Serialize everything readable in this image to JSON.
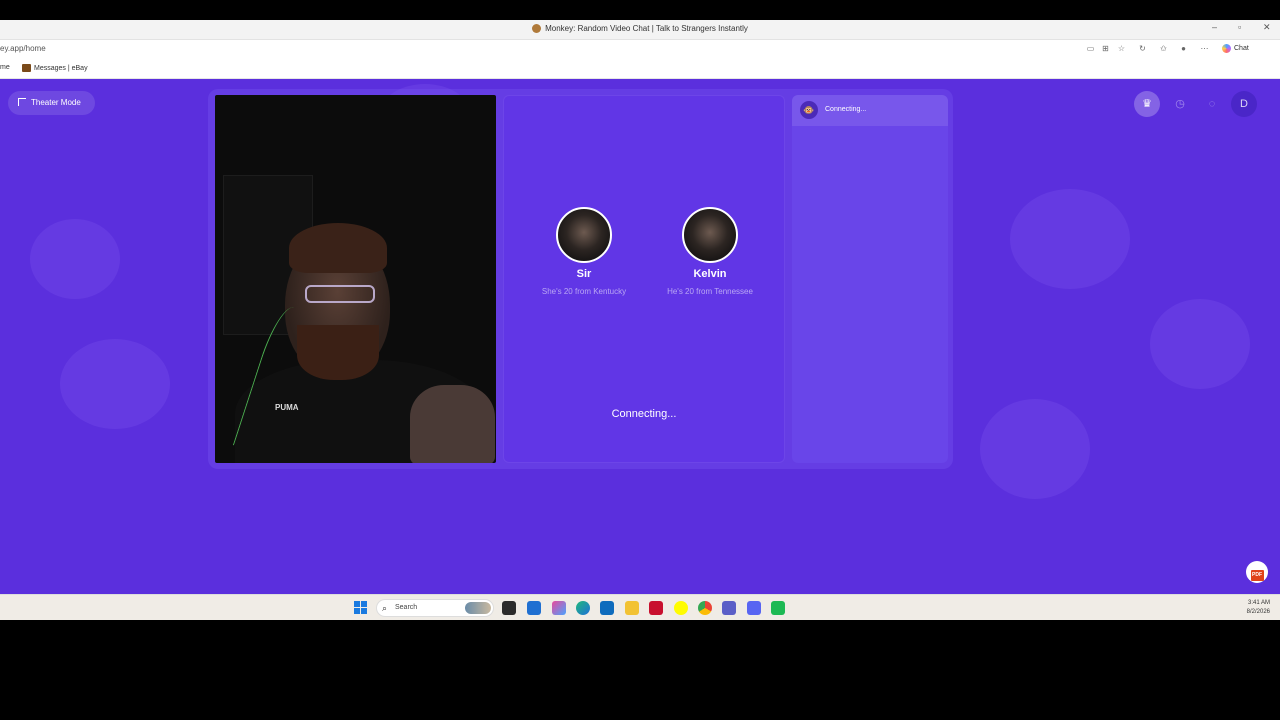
{
  "browser": {
    "window_title": "Monkey: Random Video Chat | Talk to Strangers Instantly",
    "url": "ey.app/home",
    "chat_button_label": "Chat",
    "bookmarks": [
      "me",
      "Messages | eBay"
    ]
  },
  "page": {
    "theater_button_label": "Theater Mode",
    "avatar_initial": "D",
    "top_icons": [
      "crown-icon",
      "history-icon",
      "chat-bubble-icon",
      "user-avatar"
    ]
  },
  "match": {
    "people": [
      {
        "name": "Sir",
        "meta": "She's 20 from Kentucky"
      },
      {
        "name": "Kelvin",
        "meta": "He's 20 from Tennessee"
      }
    ],
    "status": "Connecting..."
  },
  "chat": {
    "header_status": "Connecting..."
  },
  "self_video": {
    "shirt_logo": "PUMA"
  },
  "taskbar": {
    "search_placeholder": "Search",
    "time": "3:41 AM",
    "date": "8/2/2026"
  },
  "colors": {
    "page_background": "#5b2fdd",
    "match_panel": "#6136e6"
  }
}
